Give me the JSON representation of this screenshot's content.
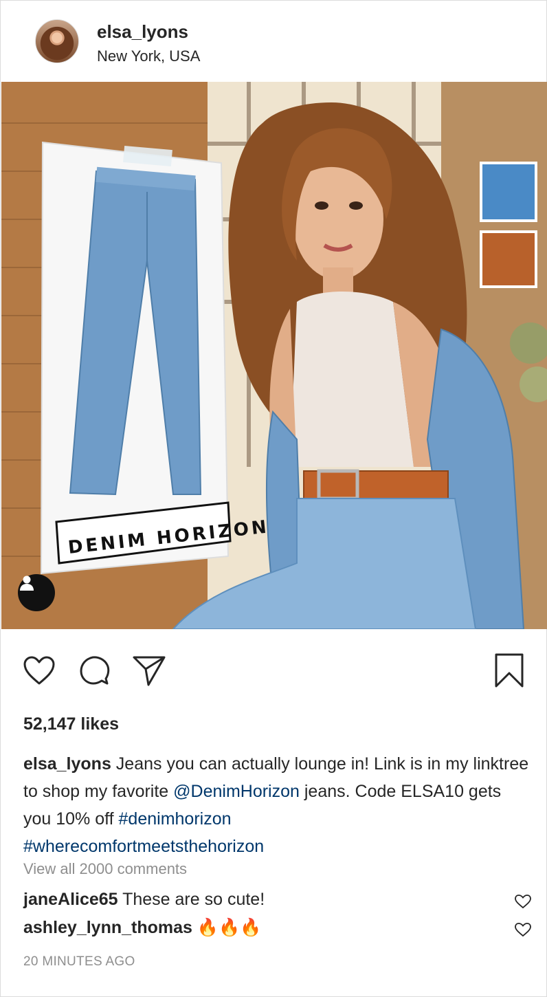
{
  "header": {
    "username": "elsa_lyons",
    "location": "New York, USA"
  },
  "photo": {
    "poster_brand_text": "DENIM HORIZON"
  },
  "actions": {
    "icons": [
      "heart-icon",
      "comment-icon",
      "share-icon",
      "bookmark-icon"
    ]
  },
  "likes": "52,147 likes",
  "caption": {
    "username": "elsa_lyons",
    "text_1": " Jeans you can actually lounge in! Link is in my linktree to shop my favorite ",
    "mention": "@DenimHorizon",
    "text_2": " jeans. Code ELSA10 gets you 10% off ",
    "hashtag_1": "#denimhorizon",
    "hashtag_2": "#wherecomfortmeetsthehorizon"
  },
  "view_all_comments": "View all 2000 comments",
  "comments": [
    {
      "username": "janeAlice65",
      "text": " These are so cute!"
    },
    {
      "username": "ashley_lynn_thomas",
      "text": " 🔥🔥🔥"
    }
  ],
  "timestamp": "20 MINUTES AGO",
  "colors": {
    "link": "#00376b",
    "secondary_text": "#8e8e8e",
    "primary_text": "#262626"
  }
}
